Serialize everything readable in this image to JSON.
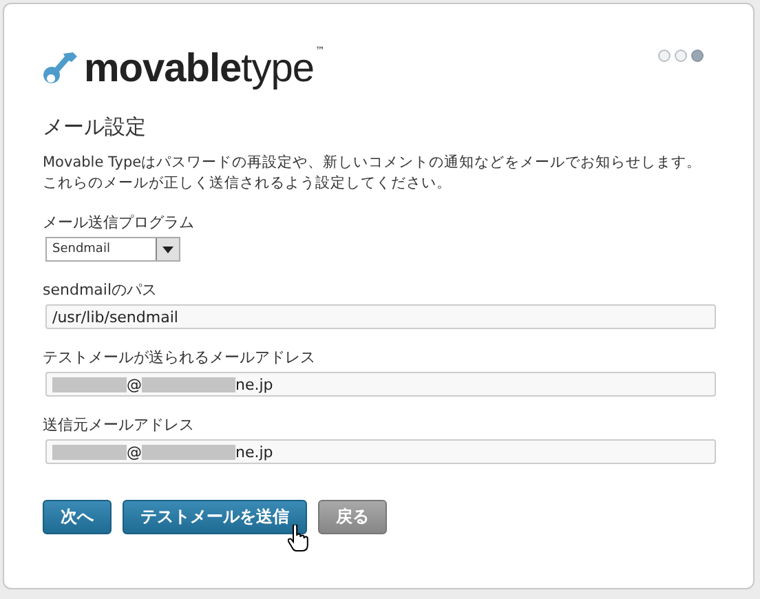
{
  "logo": {
    "bold": "movable",
    "light": "type",
    "mark": "™"
  },
  "steps": [
    {
      "selected": false
    },
    {
      "selected": false
    },
    {
      "selected": true
    }
  ],
  "title": "メール設定",
  "description": "Movable Typeはパスワードの再設定や、新しいコメントの通知などをメールでお知らせします。これらのメールが正しく送信されるよう設定してください。",
  "fields": [
    {
      "kind": "select",
      "label": "メール送信プログラム",
      "value": "Sendmail"
    },
    {
      "kind": "text",
      "label": "sendmailのパス",
      "value": "/usr/lib/sendmail"
    },
    {
      "kind": "email",
      "label": "テストメールが送られるメールアドレス",
      "parts": [
        {
          "kind": "redacted"
        },
        {
          "kind": "text",
          "text": "@"
        },
        {
          "kind": "redacted"
        },
        {
          "kind": "text",
          "text": "ne.jp"
        }
      ]
    },
    {
      "kind": "email",
      "label": "送信元メールアドレス",
      "parts": [
        {
          "kind": "redacted"
        },
        {
          "kind": "text",
          "text": "@"
        },
        {
          "kind": "redacted"
        },
        {
          "kind": "text",
          "text": "ne.jp"
        }
      ]
    }
  ],
  "buttons": [
    {
      "label": "次へ",
      "kind": "primary"
    },
    {
      "label": "テストメールを送信",
      "kind": "primary"
    },
    {
      "label": "戻る",
      "kind": "secondary"
    }
  ]
}
